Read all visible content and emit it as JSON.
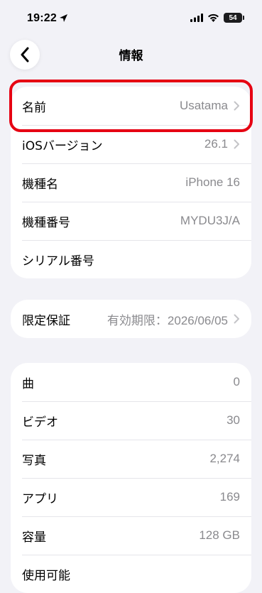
{
  "status_bar": {
    "time": "19:22",
    "battery": "54"
  },
  "nav": {
    "title": "情報"
  },
  "group1": [
    {
      "label": "名前",
      "value": "Usatama",
      "chevron": true
    },
    {
      "label": "iOSバージョン",
      "value": "26.1",
      "chevron": true
    },
    {
      "label": "機種名",
      "value": "iPhone 16",
      "chevron": false
    },
    {
      "label": "機種番号",
      "value": "MYDU3J/A",
      "chevron": false
    },
    {
      "label": "シリアル番号",
      "value": "",
      "chevron": false
    }
  ],
  "group2": [
    {
      "label": "限定保証",
      "value": "有効期限：2026/06/05",
      "chevron": true
    }
  ],
  "group3": [
    {
      "label": "曲",
      "value": "0"
    },
    {
      "label": "ビデオ",
      "value": "30"
    },
    {
      "label": "写真",
      "value": "2,274"
    },
    {
      "label": "アプリ",
      "value": "169"
    },
    {
      "label": "容量",
      "value": "128 GB"
    },
    {
      "label": "使用可能",
      "value": ""
    }
  ],
  "colors": {
    "highlight": "#e60012",
    "background": "#f2f2f7"
  }
}
